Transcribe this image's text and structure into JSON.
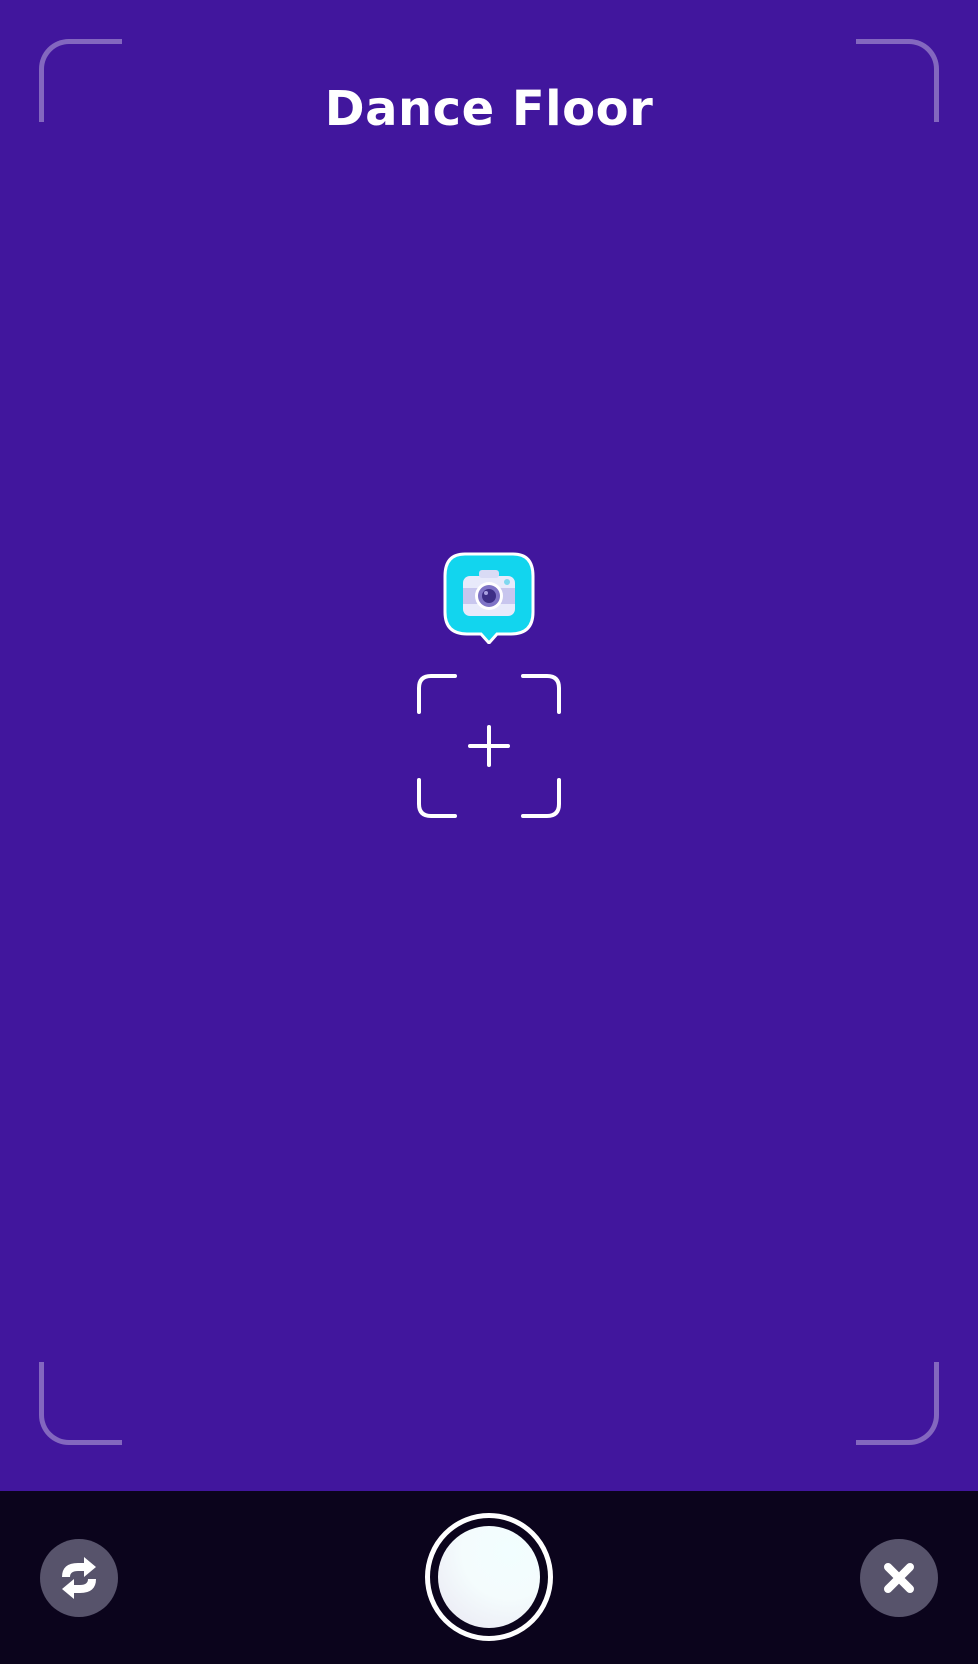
{
  "header": {
    "title": "Dance Floor"
  },
  "badge": {
    "icon": "camera-icon",
    "color": "#12d5ee"
  },
  "reticle": {
    "icon": "plus-icon"
  },
  "controls": {
    "flip_icon": "flip-camera-icon",
    "shutter_icon": "shutter-button",
    "close_icon": "close-icon"
  },
  "colors": {
    "background": "#41169d",
    "bottom_bar": "#0b041c",
    "button": "#57536b"
  }
}
